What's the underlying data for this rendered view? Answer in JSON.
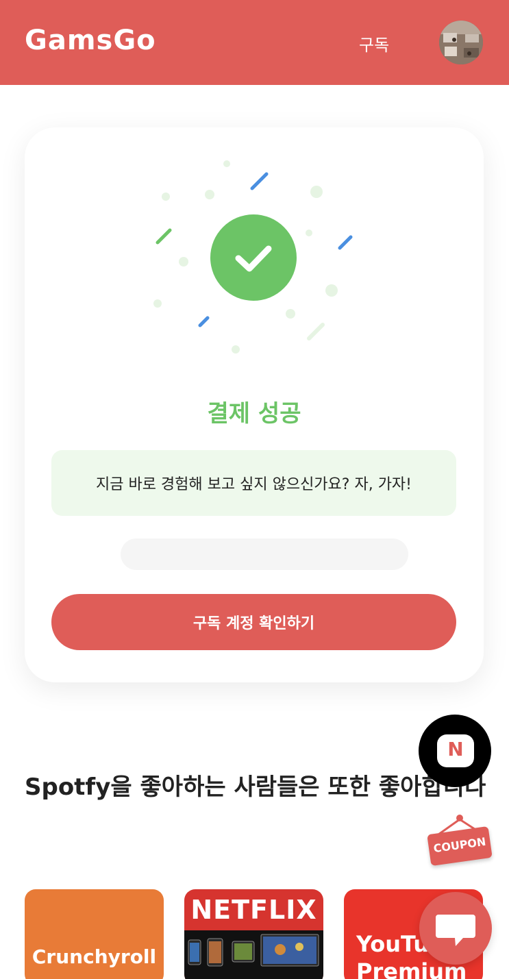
{
  "header": {
    "logo": "GamsGo",
    "nav_subscribe": "구독"
  },
  "success_card": {
    "title": "결제 성공",
    "message": "지금 바로 경험해 보고 싶지 않으신가요? 자, 가자!",
    "button_label": "구독 계정 확인하기"
  },
  "recommend": {
    "title": "Spotfy을 좋아하는 사람들은 또한 좋아합니다",
    "cards": [
      {
        "label": "Crunchyroll"
      },
      {
        "label": "NETFLIX"
      },
      {
        "label": "YouTube Premium"
      }
    ]
  },
  "floating": {
    "n_badge": "N",
    "coupon_label": "COUPON"
  },
  "colors": {
    "brand": "#df5d58",
    "success": "#6cc466",
    "success_bg": "#eef9ec"
  }
}
